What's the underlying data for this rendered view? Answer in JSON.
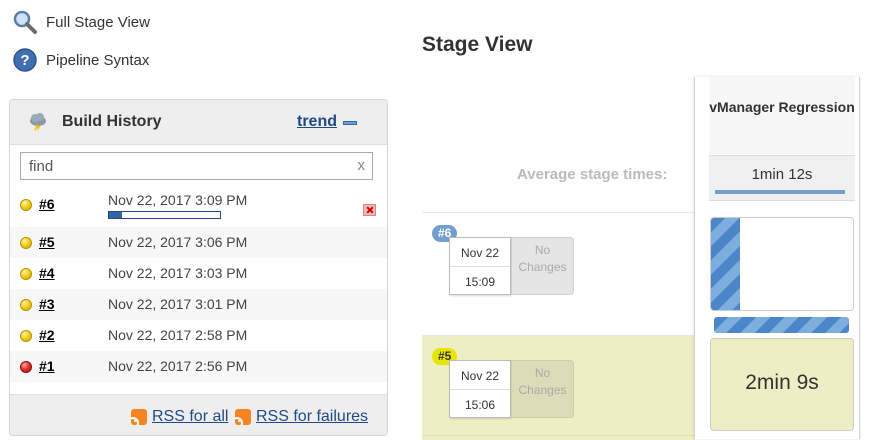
{
  "side_links": {
    "full_stage": {
      "label": "Full Stage View",
      "icon": "magnifier-icon"
    },
    "pipeline_syntax": {
      "label": "Pipeline Syntax",
      "icon": "help-icon"
    }
  },
  "build_history": {
    "title": "Build History",
    "trend_label": "trend",
    "search": {
      "value": "find",
      "clear": "x"
    },
    "builds": [
      {
        "number": "#6",
        "date": "Nov 22, 2017 3:09 PM",
        "status": "yellow",
        "in_progress": true,
        "progress": 0.12
      },
      {
        "number": "#5",
        "date": "Nov 22, 2017 3:06 PM",
        "status": "yellow"
      },
      {
        "number": "#4",
        "date": "Nov 22, 2017 3:03 PM",
        "status": "yellow"
      },
      {
        "number": "#3",
        "date": "Nov 22, 2017 3:01 PM",
        "status": "yellow"
      },
      {
        "number": "#2",
        "date": "Nov 22, 2017 2:58 PM",
        "status": "yellow"
      },
      {
        "number": "#1",
        "date": "Nov 22, 2017 2:56 PM",
        "status": "red"
      }
    ],
    "rss_all": "RSS for all",
    "rss_failures": "RSS for failures"
  },
  "stage_view": {
    "title": "Stage View",
    "avg_label": "Average stage times:",
    "stage": {
      "name": "vManager Regression",
      "avg_time": "1min 12s"
    },
    "runs": [
      {
        "badge": "#6",
        "date": "Nov 22",
        "time": "15:09",
        "changes": "No Changes",
        "stage_progress": 0.2
      },
      {
        "badge": "#5",
        "date": "Nov 22",
        "time": "15:06",
        "changes": "No Changes",
        "stage_time": "2min 9s"
      }
    ]
  },
  "colors": {
    "link": "#204a87",
    "progress_blue": "#3465a4",
    "unstable_yellow": "#eeeec4",
    "running_stripe": "#4a86c8"
  }
}
